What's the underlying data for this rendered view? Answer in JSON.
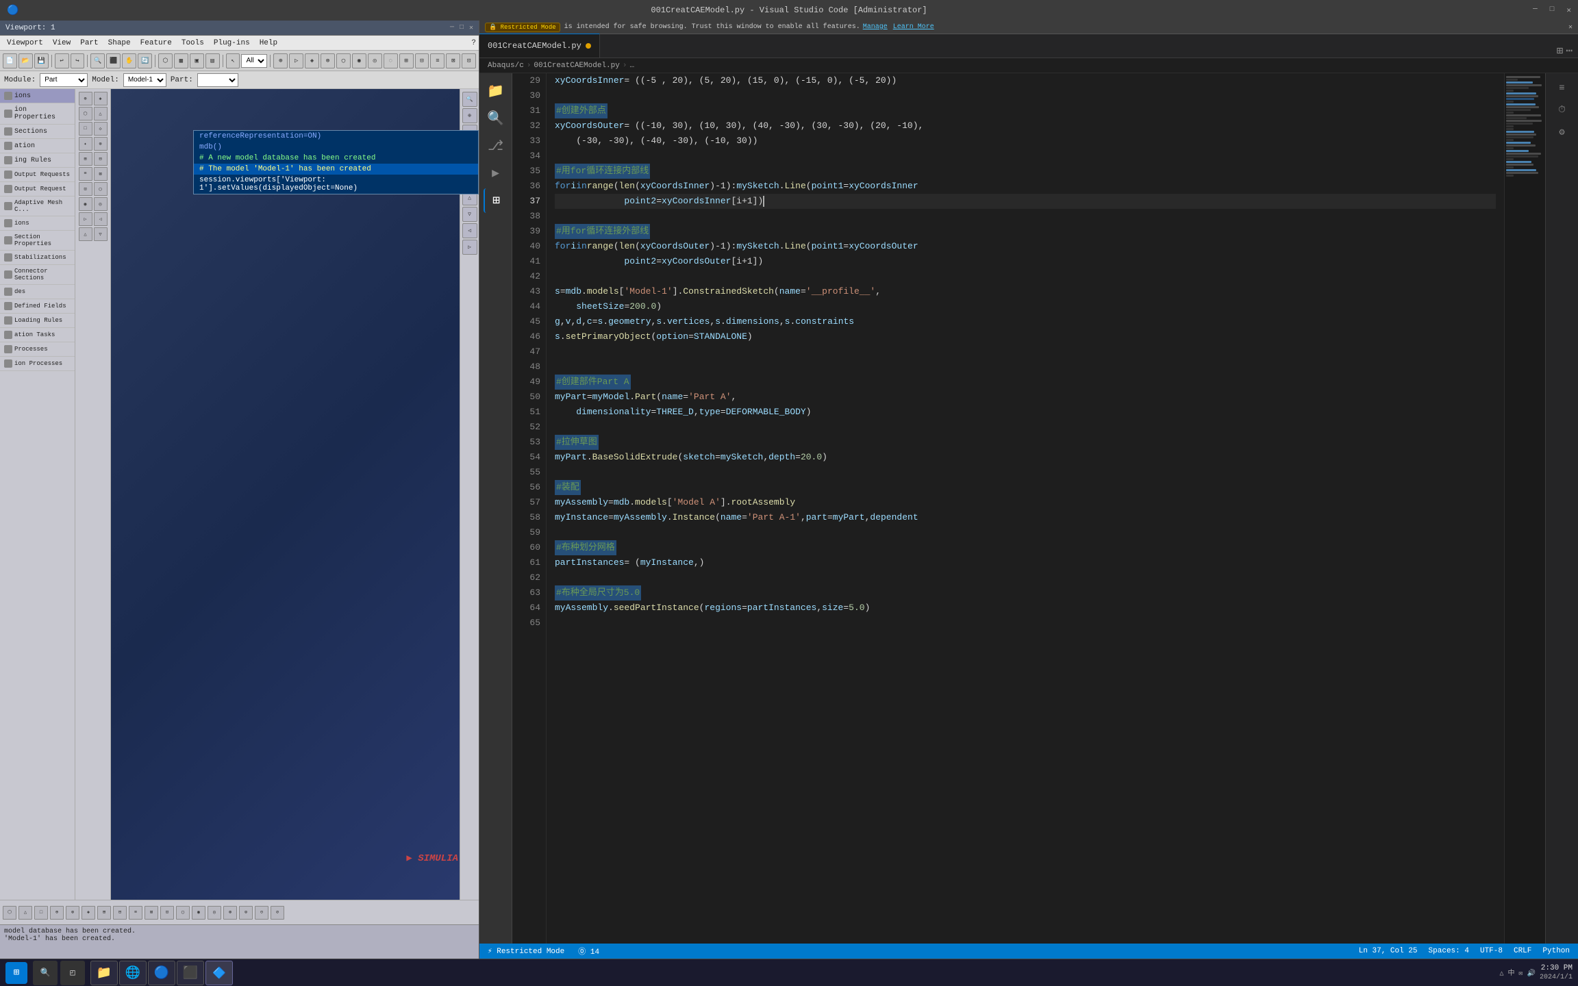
{
  "abaqus": {
    "title": "Viewport: 1",
    "menubar": {
      "items": [
        "Viewport",
        "View",
        "Part",
        "Shape",
        "Feature",
        "Tools",
        "Plug-ins",
        "Help"
      ]
    },
    "module_row": {
      "module_label": "Module:",
      "module_value": "Part",
      "model_label": "Model:",
      "model_value": "Model-1",
      "part_label": "Part:"
    },
    "sidebar": {
      "items": [
        {
          "label": "ions",
          "type": "section"
        },
        {
          "label": "ion Properties",
          "type": "item"
        },
        {
          "label": "Sections",
          "type": "item"
        },
        {
          "label": "ation",
          "type": "item"
        },
        {
          "label": "ing Rules",
          "type": "item"
        },
        {
          "label": "Output Requests",
          "type": "item"
        },
        {
          "label": "Output Requests",
          "type": "item"
        },
        {
          "label": "Adaptive Mesh C...",
          "type": "item"
        },
        {
          "label": "ions",
          "type": "item"
        },
        {
          "label": "Section Properties",
          "type": "item"
        },
        {
          "label": "Stabilizations",
          "type": "item"
        },
        {
          "label": "Connector Sections",
          "type": "item"
        },
        {
          "label": "des",
          "type": "item"
        },
        {
          "label": "Defined Fields",
          "type": "item"
        },
        {
          "label": "Loading Rules",
          "type": "item"
        },
        {
          "label": "ation Tasks",
          "type": "item"
        },
        {
          "label": "Processes",
          "type": "item"
        },
        {
          "label": "ion Processes",
          "type": "item"
        }
      ]
    },
    "context_popup": {
      "lines": [
        {
          "text": "referenceRepresentation=ON)",
          "type": "code"
        },
        {
          "text": "mdb()",
          "type": "code"
        },
        {
          "text": "# A new model database has been created",
          "type": "green"
        },
        {
          "text": "# The model 'Model-1' has been created",
          "type": "highlighted"
        },
        {
          "text": "session.viewports['Viewport: 1'].setValues(displayedObject=None)",
          "type": "white"
        }
      ]
    },
    "simulia_logo": "SIMULIA",
    "status_messages": [
      "model database has been created.",
      "'Model-1' has been created."
    ]
  },
  "vscode": {
    "window_title": "001CreatCAEModel.py - Visual Studio Code [Administrator]",
    "restricted_mode": {
      "badge": "Restricted Mode",
      "message": "is intended for safe browsing. Trust this window to enable all features.",
      "manage": "Manage",
      "learn_more": "Learn More"
    },
    "tab": {
      "filename": "001CreatCAEModel.py",
      "dot_modified": true
    },
    "breadcrumb": {
      "parts": [
        "Abaqus/c",
        ">",
        "001CreatCAEModel.py",
        ">",
        "..."
      ]
    },
    "statusbar": {
      "restricted_mode": "⚡ Restricted Mode",
      "errors": "⓪ 14",
      "line_col": "Ln 37, Col 25",
      "spaces": "Spaces: 4",
      "encoding": "UTF-8",
      "line_ending": "CRLF",
      "language": "Python"
    },
    "code": {
      "lines": [
        {
          "num": 29,
          "content": "xyCoordsInner = ((-5 , 20), (5, 20), (15, 0), (-15, 0), (-5, 20))"
        },
        {
          "num": 30,
          "content": ""
        },
        {
          "num": 31,
          "content": "#创建外部点",
          "comment_cn": true
        },
        {
          "num": 32,
          "content": "xyCoordsOuter = ((-10, 30), (10, 30), (40, -30), (30, -30), (20, -10),"
        },
        {
          "num": 33,
          "content": "    (-30, -30), (-40, -30), (-10, 30))"
        },
        {
          "num": 34,
          "content": ""
        },
        {
          "num": 35,
          "content": "#用for循环连接内部线",
          "comment_cn": true
        },
        {
          "num": 36,
          "content": "for i in range(len(xyCoordsInner)-1): mySketch.Line(point1=xyCoordsInner"
        },
        {
          "num": 37,
          "content": "        point2=xyCoordsInner[i+1])",
          "highlighted": true
        },
        {
          "num": 38,
          "content": ""
        },
        {
          "num": 39,
          "content": "#用for循环连接外部线",
          "comment_cn": true
        },
        {
          "num": 40,
          "content": "for i in range(len(xyCoordsOuter)-1): mySketch.Line(point1=xyCoordsOuter"
        },
        {
          "num": 41,
          "content": "        point2=xyCoordsOuter[i+1])"
        },
        {
          "num": 42,
          "content": ""
        },
        {
          "num": 43,
          "content": "s = mdb.models['Model-1'].ConstrainedSketch(name='__profile__',"
        },
        {
          "num": 44,
          "content": "    sheetSize=200.0)"
        },
        {
          "num": 45,
          "content": "g, v, d, c = s.geometry, s.vertices, s.dimensions, s.constraints"
        },
        {
          "num": 46,
          "content": "s.setPrimaryObject(option=STANDALONE)"
        },
        {
          "num": 47,
          "content": ""
        },
        {
          "num": 48,
          "content": ""
        },
        {
          "num": 49,
          "content": "#创建部件Part A",
          "comment_cn": true
        },
        {
          "num": 50,
          "content": "myPart = myModel.Part(name='Part A',"
        },
        {
          "num": 51,
          "content": "    dimensionality=THREE_D, type=DEFORMABLE_BODY)"
        },
        {
          "num": 52,
          "content": ""
        },
        {
          "num": 53,
          "content": "#拉伸草图",
          "comment_cn": true
        },
        {
          "num": 54,
          "content": "myPart.BaseSolidExtrude(sketch=mySketch, depth=20.0)"
        },
        {
          "num": 55,
          "content": ""
        },
        {
          "num": 56,
          "content": "#装配",
          "comment_cn": true
        },
        {
          "num": 57,
          "content": "myAssembly = mdb.models['Model A'].rootAssembly"
        },
        {
          "num": 58,
          "content": "myInstance = myAssembly.Instance(name='Part A-1', part=myPart, dependent"
        },
        {
          "num": 59,
          "content": ""
        },
        {
          "num": 60,
          "content": "#布种划分网格",
          "comment_cn": true
        },
        {
          "num": 61,
          "content": "partInstances = (myInstance,)"
        },
        {
          "num": 62,
          "content": ""
        },
        {
          "num": 63,
          "content": "#布种全局尺寸为5.0",
          "comment_cn": true
        },
        {
          "num": 64,
          "content": "myAssembly.seedPartInstance( regions=partInstances, size=5.0)"
        },
        {
          "num": 65,
          "content": ""
        }
      ]
    }
  }
}
